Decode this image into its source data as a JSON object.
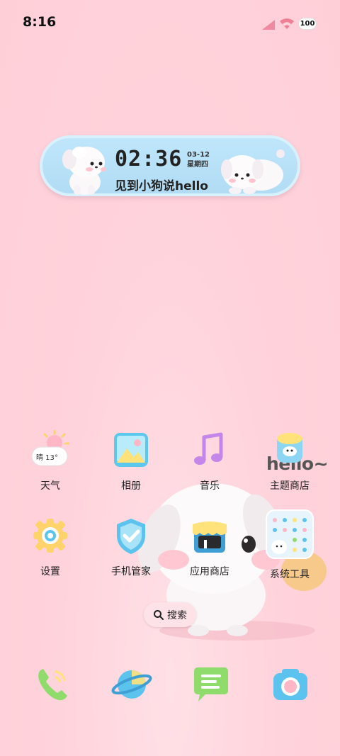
{
  "status_bar": {
    "time": "8:16",
    "battery": "100"
  },
  "widget": {
    "time": "02:36",
    "date": "03-12",
    "weekday": "星期四",
    "message": "见到小狗说hello"
  },
  "decoration": {
    "hello_text": "hello~"
  },
  "apps": [
    {
      "label": "天气",
      "icon": "weather-icon",
      "temp": "晴 13°"
    },
    {
      "label": "相册",
      "icon": "gallery-icon"
    },
    {
      "label": "音乐",
      "icon": "music-icon"
    },
    {
      "label": "主题商店",
      "icon": "theme-store-icon"
    },
    {
      "label": "设置",
      "icon": "settings-icon"
    },
    {
      "label": "手机管家",
      "icon": "security-icon"
    },
    {
      "label": "应用商店",
      "icon": "app-store-icon"
    },
    {
      "label": "系统工具",
      "icon": "system-tools-folder-icon"
    }
  ],
  "search": {
    "label": "搜索"
  },
  "dock": [
    {
      "icon": "phone-icon"
    },
    {
      "icon": "browser-icon"
    },
    {
      "icon": "messages-icon"
    },
    {
      "icon": "camera-icon"
    }
  ],
  "colors": {
    "wallpaper": "#ffd3dc",
    "widget_bg": "#bfe6fb",
    "accent_blue": "#5cc3ee",
    "accent_yellow": "#ffe27a",
    "accent_green": "#8fdc6c"
  }
}
